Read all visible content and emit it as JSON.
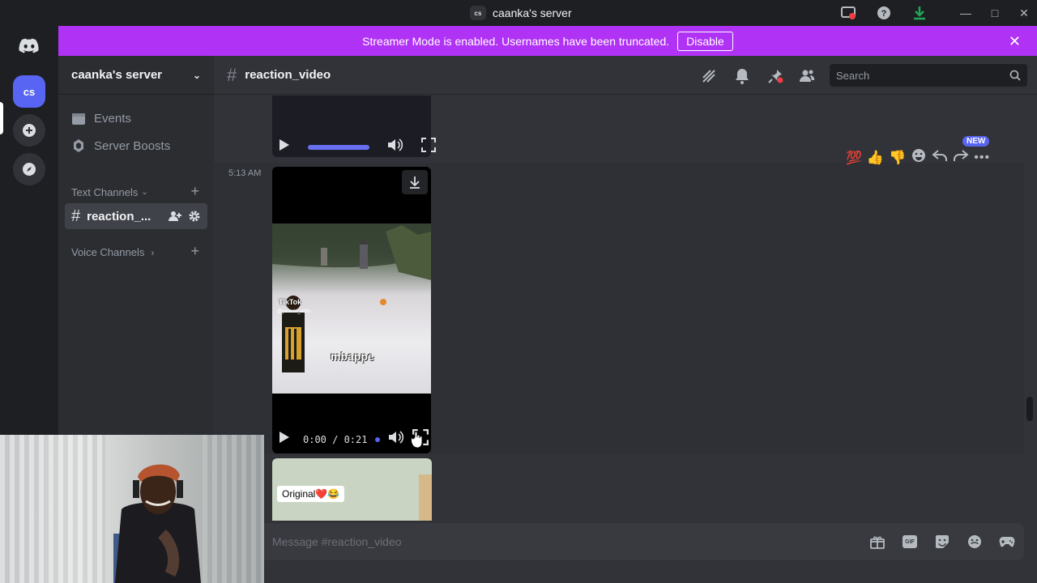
{
  "window": {
    "server_badge": "cs",
    "title": "caanka's server"
  },
  "banner": {
    "text": "Streamer Mode is enabled. Usernames have been truncated.",
    "disable_label": "Disable"
  },
  "guilds": {
    "server_abbrev": "cs"
  },
  "sidebar": {
    "server_name": "caanka's server",
    "items": [
      {
        "label": "Events",
        "icon": "calendar-icon"
      },
      {
        "label": "Server Boosts",
        "icon": "boost-icon"
      }
    ],
    "text_category": "Text Channels",
    "active_channel": "reaction_...",
    "voice_category": "Voice Channels"
  },
  "topbar": {
    "channel_name": "reaction_video",
    "search_placeholder": "Search"
  },
  "messages": {
    "timestamp": "5:13 AM",
    "video_time": "0:00 / 0:21",
    "overlay_text": "mbappe",
    "watermark": "TikTok",
    "watermark_handle": "@yaranki_edits",
    "next_caption": "Original❤️😂",
    "new_badge": "NEW",
    "reactions": [
      "💯",
      "👍",
      "👎"
    ]
  },
  "composer": {
    "placeholder": "Message #reaction_video",
    "gif_label": "GIF"
  },
  "colors": {
    "banner": "#b032f5",
    "blurple": "#5865f2",
    "background": "#313338",
    "sidebar": "#2b2d31",
    "rail": "#1e1f22"
  }
}
